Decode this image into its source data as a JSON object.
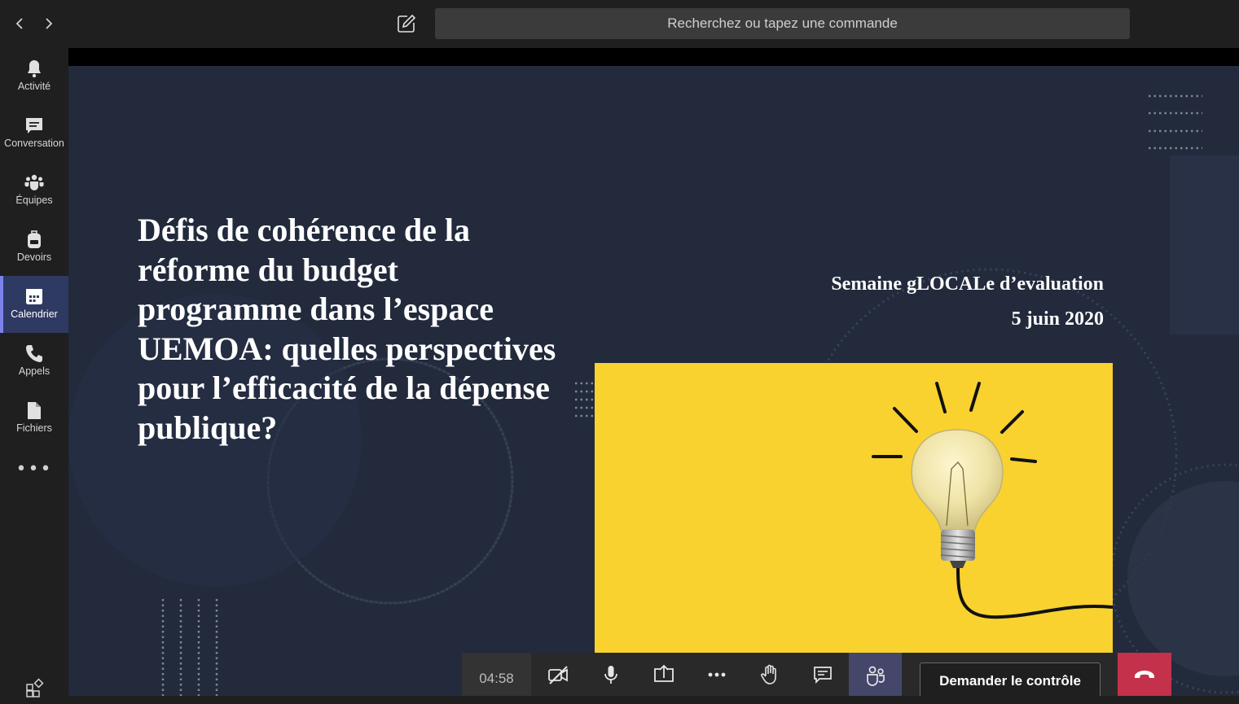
{
  "topbar": {
    "back_icon": "chevron-left",
    "forward_icon": "chevron-right",
    "compose_icon": "compose",
    "search_placeholder": "Recherchez ou tapez une commande"
  },
  "sidebar": {
    "items": [
      {
        "label": "Activité",
        "icon": "bell"
      },
      {
        "label": "Conversation",
        "icon": "chat"
      },
      {
        "label": "Équipes",
        "icon": "teams"
      },
      {
        "label": "Devoirs",
        "icon": "backpack"
      },
      {
        "label": "Calendrier",
        "icon": "calendar",
        "active": true
      },
      {
        "label": "Appels",
        "icon": "phone"
      },
      {
        "label": "Fichiers",
        "icon": "file"
      }
    ],
    "more_label": "•••",
    "apps_icon": "apps"
  },
  "slide": {
    "title": "Défis de cohérence de la réforme du budget programme dans l’espace UEMOA: quelles perspectives pour l’efficacité de la dépense publique?",
    "subtitle_line1": "Semaine  gLOCALe d’evaluation",
    "subtitle_line2": "5 juin 2020",
    "image": "lightbulb on yellow background"
  },
  "controls": {
    "timer": "04:58",
    "camera_icon": "camera-off",
    "mic_icon": "microphone",
    "share_icon": "share-screen",
    "more_icon": "more-options",
    "raise_hand_icon": "raise-hand",
    "chat_icon": "chat",
    "participants_icon": "participants",
    "request_control_label": "Demander le contrôle",
    "hangup_icon": "hang-up"
  },
  "colors": {
    "app_background": "#1f1f1f",
    "slide_background": "#222a3c",
    "accent": "#7b83eb",
    "active_rail": "#2f3a63",
    "hangup": "#c4314b",
    "slide_yellow": "#f9d22f"
  }
}
